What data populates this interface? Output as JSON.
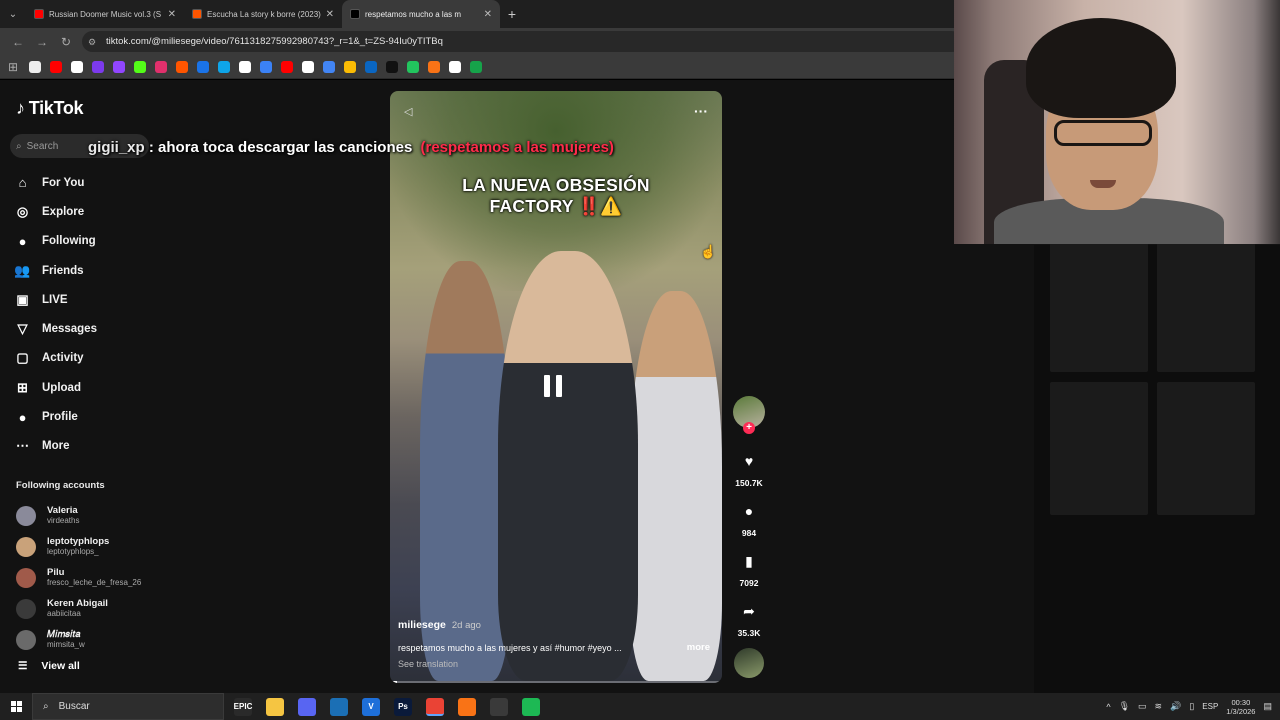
{
  "browser": {
    "tabs": [
      {
        "title": "Russian Doomer Music vol.3 (S",
        "favicon_color": "#ff0000",
        "active": false
      },
      {
        "title": "Escucha La story k borre (2023)",
        "favicon_color": "#ff5500",
        "active": false
      },
      {
        "title": "respetamos mucho a las m",
        "favicon_color": "#000000",
        "active": true
      }
    ],
    "url": "tiktok.com/@miliesege/video/7611318275992980743?_r=1&_t=ZS-94Iu0yTITBq",
    "bookmark_colors": [
      "#eeeeee",
      "#ff0000",
      "#ffffff",
      "#7c3aed",
      "#9146ff",
      "#53fc18",
      "#e1306c",
      "#ff5500",
      "#1a73e8",
      "#0ea5e9",
      "#ffffff",
      "#3b82f6",
      "#ff0000",
      "#ffffff",
      "#4285f4",
      "#fbbc04",
      "#0a66c2",
      "#111111",
      "#22c55e",
      "#f97316",
      "#ffffff",
      "#16a34a"
    ]
  },
  "tiktok": {
    "logo": "TikTok",
    "search_placeholder": "Search",
    "nav": [
      {
        "label": "For You",
        "icon": "home-icon",
        "glyph": "⌂"
      },
      {
        "label": "Explore",
        "icon": "compass-icon",
        "glyph": "◎"
      },
      {
        "label": "Following",
        "icon": "following-avatar-icon",
        "glyph": "●"
      },
      {
        "label": "Friends",
        "icon": "friends-icon",
        "glyph": "👥"
      },
      {
        "label": "LIVE",
        "icon": "live-icon",
        "glyph": "▣"
      },
      {
        "label": "Messages",
        "icon": "messages-icon",
        "glyph": "▽"
      },
      {
        "label": "Activity",
        "icon": "activity-icon",
        "glyph": "▢"
      },
      {
        "label": "Upload",
        "icon": "upload-icon",
        "glyph": "⊞"
      },
      {
        "label": "Profile",
        "icon": "profile-avatar-icon",
        "glyph": "●"
      },
      {
        "label": "More",
        "icon": "more-dots-icon",
        "glyph": "⋯"
      }
    ],
    "following_header": "Following accounts",
    "following_accounts": [
      {
        "name": "Valeria",
        "handle": "virdeaths",
        "color": "#8a8a9a"
      },
      {
        "name": "leptotyphlops",
        "handle": "leptotyphlops_",
        "color": "#c9a27a"
      },
      {
        "name": "Pilu",
        "handle": "fresco_leche_de_fresa_26",
        "color": "#a05a4a"
      },
      {
        "name": "Keren Abigail",
        "handle": "aabiicitaa",
        "color": "#3a3a3a"
      },
      {
        "name": "𝑀𝑖𝑚𝑠𝑖𝑡𝑎",
        "handle": "mimsita_w",
        "color": "#6a6a6a"
      }
    ],
    "view_all": "View all"
  },
  "video": {
    "caption_line1": "LA NUEVA OBSESIÓN",
    "caption_line2": "FACTORY",
    "caption_emoji": "‼️⚠️",
    "author": "miliesege",
    "age": "2d ago",
    "description": "respetamos mucho a las mujeres y así #humor #yeyo ...",
    "more": "more",
    "see_translation": "See translation",
    "progress": 0.02
  },
  "actions": {
    "likes": "150.7K",
    "comments": "984",
    "saves": "7092",
    "shares": "35.3K"
  },
  "overlay": {
    "user": "gigii_xp",
    "message": ": ahora toca descargar las canciones",
    "highlight": "(respetamos a las mujeres)"
  },
  "taskbar": {
    "search_placeholder": "Buscar",
    "apps": [
      {
        "name": "epic-games-icon",
        "label": "EPIC",
        "color": "#2a2a2a"
      },
      {
        "name": "file-explorer-icon",
        "label": "",
        "color": "#f5c542"
      },
      {
        "name": "discord-icon",
        "label": "",
        "color": "#5865f2"
      },
      {
        "name": "steam-icon",
        "label": "",
        "color": "#1b6fb5"
      },
      {
        "name": "vscode-icon",
        "label": "V",
        "color": "#1e6fd9"
      },
      {
        "name": "photoshop-icon",
        "label": "Ps",
        "color": "#0a1a3a"
      },
      {
        "name": "chrome-icon",
        "label": "",
        "color": "#ea4335"
      },
      {
        "name": "app-icon",
        "label": "",
        "color": "#f97316"
      },
      {
        "name": "obs-icon",
        "label": "",
        "color": "#3a3a3a"
      },
      {
        "name": "spotify-icon",
        "label": "",
        "color": "#1db954"
      }
    ],
    "language": "ESP",
    "time": "00:30",
    "date": "1/3/2026"
  }
}
